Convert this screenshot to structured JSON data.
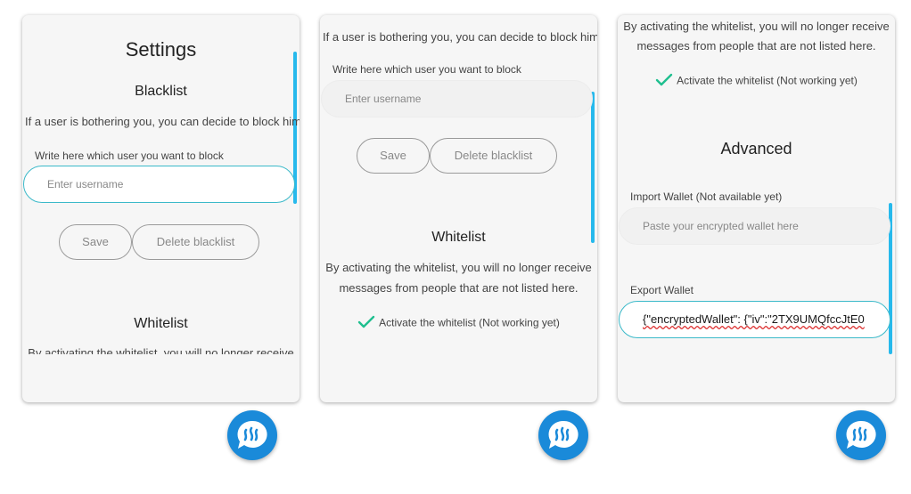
{
  "accent_color": "#27b9ec",
  "fab_color": "#1a8ad9",
  "fab_icon": "steem-chat-icon",
  "screens": [
    {
      "settings_title": "Settings",
      "blacklist_title": "Blacklist",
      "blacklist_description": "If a user is bothering you, you can decide to block him.",
      "block_label": "Write here which user you want to block",
      "username_placeholder": "Enter username",
      "save_label": "Save",
      "delete_label": "Delete blacklist",
      "whitelist_title": "Whitelist",
      "whitelist_partial_text": "By activating the whitelist, you will no longer receive"
    },
    {
      "blacklist_description": "If a user is bothering you, you can decide to block him.",
      "block_label": "Write here which user you want to block",
      "username_placeholder": "Enter username",
      "save_label": "Save",
      "delete_label": "Delete blacklist",
      "whitelist_title": "Whitelist",
      "whitelist_desc_line1": "By activating the whitelist, you will no longer receive",
      "whitelist_desc_line2": "messages from people that are not listed here.",
      "whitelist_checkbox_label": "Activate the whitelist (Not working yet)"
    },
    {
      "whitelist_desc_line1": "By activating the whitelist, you will no longer receive",
      "whitelist_desc_line2": "messages from people that are not listed here.",
      "whitelist_checkbox_label": "Activate the whitelist (Not working yet)",
      "advanced_title": "Advanced",
      "import_label": "Import Wallet (Not available yet)",
      "import_placeholder": "Paste your encrypted wallet here",
      "export_label": "Export Wallet",
      "export_value": "{\"encryptedWallet\": {\"iv\":\"2TX9UMQfccJtE0"
    }
  ]
}
